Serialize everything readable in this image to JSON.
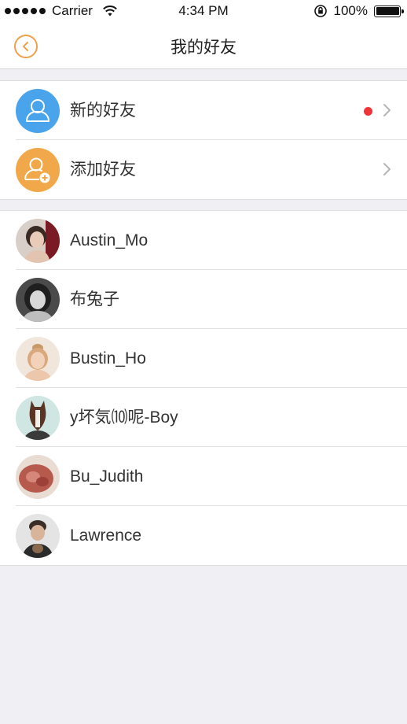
{
  "status_bar": {
    "carrier": "Carrier",
    "time": "4:34 PM",
    "battery": "100%"
  },
  "nav": {
    "title": "我的好友",
    "back_icon": "chevron-left-circle-icon",
    "accent_color": "#f0a04b"
  },
  "actions": [
    {
      "label": "新的好友",
      "icon": "person-icon",
      "color": "#4aa4ec",
      "has_badge": true
    },
    {
      "label": "添加好友",
      "icon": "person-add-icon",
      "color": "#f0a84a",
      "has_badge": false
    }
  ],
  "friends": [
    {
      "name": "Austin_Mo"
    },
    {
      "name": "布兔子"
    },
    {
      "name": "Bustin_Ho"
    },
    {
      "name": "y坏気⑽呢-Boy"
    },
    {
      "name": "Bu_Judith"
    },
    {
      "name": "Lawrence"
    }
  ],
  "badge_color": "#f0343a"
}
